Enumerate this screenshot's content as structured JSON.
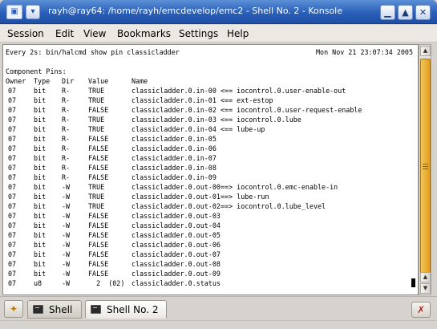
{
  "window": {
    "title": "rayh@ray64: /home/rayh/emcdevelop/emc2 - Shell No. 2 - Konsole",
    "icon": "konsole-icon",
    "buttons": {
      "minimize": "▁",
      "maximize": "▲",
      "close": "✕"
    }
  },
  "menubar": {
    "items": [
      "Session",
      "Edit",
      "View",
      "Bookmarks",
      "Settings",
      "Help"
    ]
  },
  "terminal": {
    "watch_header": "Every 2s: bin/halcmd show pin classicladder",
    "timestamp": "Mon Nov 21 23:07:34 2005",
    "section_title": "Component Pins:",
    "columns": [
      "Owner",
      "Type",
      "Dir",
      "Value",
      "Name"
    ],
    "rows": [
      {
        "owner": "07",
        "type": "bit",
        "dir": "R-",
        "value": "TRUE",
        "name": "classicladder.0.in-00",
        "link": "<== iocontrol.0.user-enable-out"
      },
      {
        "owner": "07",
        "type": "bit",
        "dir": "R-",
        "value": "TRUE",
        "name": "classicladder.0.in-01",
        "link": "<== ext-estop"
      },
      {
        "owner": "07",
        "type": "bit",
        "dir": "R-",
        "value": "FALSE",
        "name": "classicladder.0.in-02",
        "link": "<== iocontrol.0.user-request-enable"
      },
      {
        "owner": "07",
        "type": "bit",
        "dir": "R-",
        "value": "TRUE",
        "name": "classicladder.0.in-03",
        "link": "<== iocontrol.0.lube"
      },
      {
        "owner": "07",
        "type": "bit",
        "dir": "R-",
        "value": "TRUE",
        "name": "classicladder.0.in-04",
        "link": "<== lube-up"
      },
      {
        "owner": "07",
        "type": "bit",
        "dir": "R-",
        "value": "FALSE",
        "name": "classicladder.0.in-05",
        "link": ""
      },
      {
        "owner": "07",
        "type": "bit",
        "dir": "R-",
        "value": "FALSE",
        "name": "classicladder.0.in-06",
        "link": ""
      },
      {
        "owner": "07",
        "type": "bit",
        "dir": "R-",
        "value": "FALSE",
        "name": "classicladder.0.in-07",
        "link": ""
      },
      {
        "owner": "07",
        "type": "bit",
        "dir": "R-",
        "value": "FALSE",
        "name": "classicladder.0.in-08",
        "link": ""
      },
      {
        "owner": "07",
        "type": "bit",
        "dir": "R-",
        "value": "FALSE",
        "name": "classicladder.0.in-09",
        "link": ""
      },
      {
        "owner": "07",
        "type": "bit",
        "dir": "-W",
        "value": "TRUE",
        "name": "classicladder.0.out-00",
        "link": "==> iocontrol.0.emc-enable-in"
      },
      {
        "owner": "07",
        "type": "bit",
        "dir": "-W",
        "value": "TRUE",
        "name": "classicladder.0.out-01",
        "link": "==> lube-run"
      },
      {
        "owner": "07",
        "type": "bit",
        "dir": "-W",
        "value": "TRUE",
        "name": "classicladder.0.out-02",
        "link": "==> iocontrol.0.lube_level"
      },
      {
        "owner": "07",
        "type": "bit",
        "dir": "-W",
        "value": "FALSE",
        "name": "classicladder.0.out-03",
        "link": ""
      },
      {
        "owner": "07",
        "type": "bit",
        "dir": "-W",
        "value": "FALSE",
        "name": "classicladder.0.out-04",
        "link": ""
      },
      {
        "owner": "07",
        "type": "bit",
        "dir": "-W",
        "value": "FALSE",
        "name": "classicladder.0.out-05",
        "link": ""
      },
      {
        "owner": "07",
        "type": "bit",
        "dir": "-W",
        "value": "FALSE",
        "name": "classicladder.0.out-06",
        "link": ""
      },
      {
        "owner": "07",
        "type": "bit",
        "dir": "-W",
        "value": "FALSE",
        "name": "classicladder.0.out-07",
        "link": ""
      },
      {
        "owner": "07",
        "type": "bit",
        "dir": "-W",
        "value": "FALSE",
        "name": "classicladder.0.out-08",
        "link": ""
      },
      {
        "owner": "07",
        "type": "bit",
        "dir": "-W",
        "value": "FALSE",
        "name": "classicladder.0.out-09",
        "link": ""
      },
      {
        "owner": "07",
        "type": "u8",
        "dir": "-W",
        "value": "  2  (02)",
        "name": "classicladder.0.status",
        "link": ""
      }
    ]
  },
  "tabs": {
    "new_tab_icon": "new-session-icon",
    "items": [
      {
        "label": "Shell",
        "active": false
      },
      {
        "label": "Shell No. 2",
        "active": true
      }
    ],
    "close_icon": "close-session-icon"
  },
  "colors": {
    "titlebar": "#2a5fb8",
    "scrollbar_thumb": "#e39f1c",
    "terminal_bg": "#ffffff"
  }
}
